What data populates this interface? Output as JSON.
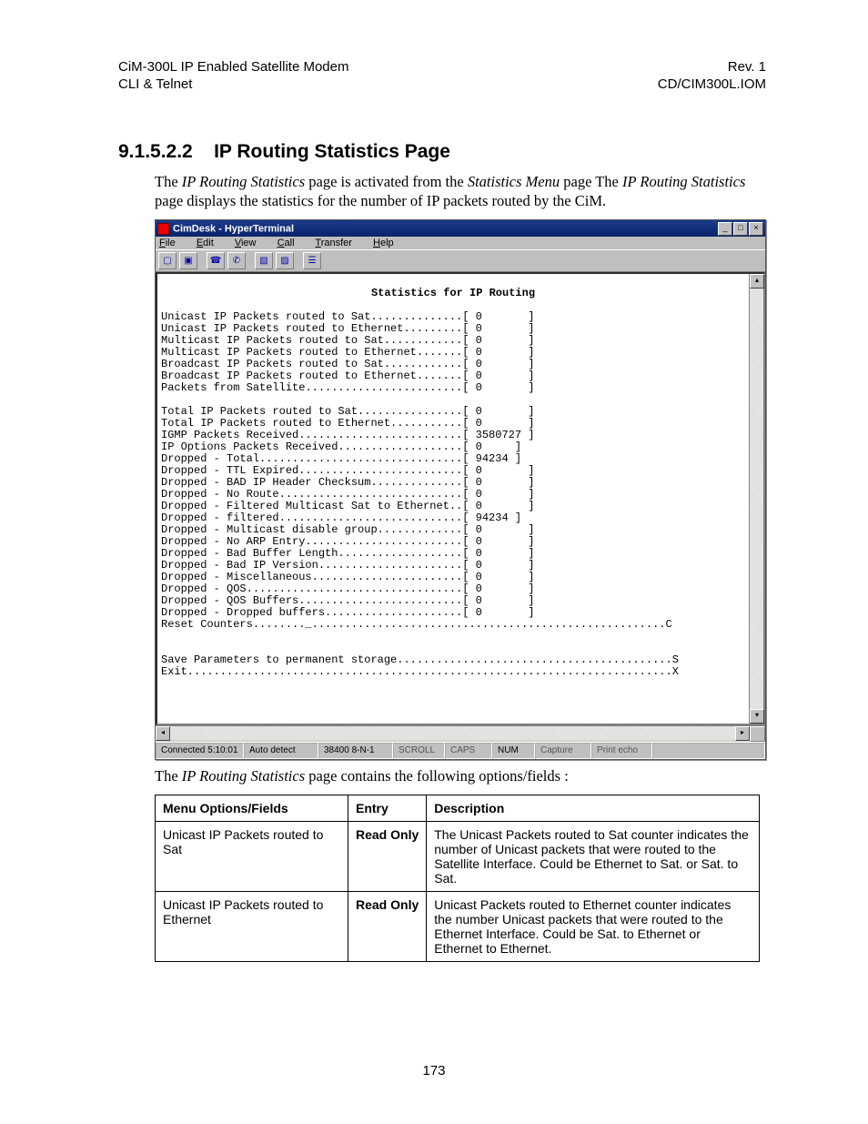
{
  "header": {
    "left_line1": "CiM-300L IP Enabled Satellite Modem",
    "left_line2": "CLI & Telnet",
    "right_line1": "Rev. 1",
    "right_line2": "CD/CIM300L.IOM"
  },
  "section": {
    "number": "9.1.5.2.2",
    "title": "IP Routing Statistics Page"
  },
  "intro": {
    "p1_pre": "The ",
    "p1_i1": "IP Routing Statistics",
    "p1_mid1": " page is activated from the ",
    "p1_i2": "Statistics Menu",
    "p1_mid2": " page The ",
    "p1_i3": "IP Routing Statistics",
    "p1_post": " page displays the statistics for the number of IP packets routed by the CiM."
  },
  "terminal": {
    "title": "CimDesk - HyperTerminal",
    "menus": {
      "file": "File",
      "edit": "Edit",
      "view": "View",
      "call": "Call",
      "transfer": "Transfer",
      "help": "Help"
    },
    "win_min": "_",
    "win_max": "□",
    "win_close": "×",
    "heading": "Statistics for IP Routing",
    "lines": [
      "Unicast IP Packets routed to Sat..............[ 0       ]",
      "Unicast IP Packets routed to Ethernet.........[ 0       ]",
      "Multicast IP Packets routed to Sat............[ 0       ]",
      "Multicast IP Packets routed to Ethernet.......[ 0       ]",
      "Broadcast IP Packets routed to Sat............[ 0       ]",
      "Broadcast IP Packets routed to Ethernet.......[ 0       ]",
      "Packets from Satellite........................[ 0       ]",
      "",
      "Total IP Packets routed to Sat................[ 0       ]",
      "Total IP Packets routed to Ethernet...........[ 0       ]",
      "IGMP Packets Received.........................[ 3580727 ]",
      "IP Options Packets Received...................[ 0     ]",
      "Dropped - Total...............................[ 94234 ]",
      "Dropped - TTL Expired.........................[ 0       ]",
      "Dropped - BAD IP Header Checksum..............[ 0       ]",
      "Dropped - No Route............................[ 0       ]",
      "Dropped - Filtered Multicast Sat to Ethernet..[ 0       ]",
      "Dropped - filtered............................[ 94234 ]",
      "Dropped - Multicast disable group.............[ 0       ]",
      "Dropped - No ARP Entry........................[ 0       ]",
      "Dropped - Bad Buffer Length...................[ 0       ]",
      "Dropped - Bad IP Version......................[ 0       ]",
      "Dropped - Miscellaneous.......................[ 0       ]",
      "Dropped - QOS.................................[ 0       ]",
      "Dropped - QOS Buffers.........................[ 0       ]",
      "Dropped - Dropped buffers.....................[ 0       ]",
      "Reset Counters........_......................................................C",
      "",
      "",
      "Save Parameters to permanent storage..........................................S",
      "Exit..........................................................................X"
    ],
    "status": {
      "connected": "Connected 5:10:01",
      "detect": "Auto detect",
      "baud": "38400 8-N-1",
      "scroll": "SCROLL",
      "caps": "CAPS",
      "num": "NUM",
      "capture": "Capture",
      "printecho": "Print echo"
    },
    "scroll_up": "▴",
    "scroll_down": "▾",
    "scroll_left": "◂",
    "scroll_right": "▸"
  },
  "after_term": {
    "pre": "The ",
    "ital": "IP Routing Statistics",
    "post": " page contains the following options/fields :"
  },
  "table": {
    "head": {
      "c1": "Menu Options/Fields",
      "c2": "Entry",
      "c3": "Description"
    },
    "rows": [
      {
        "c1": "Unicast IP Packets routed to Sat",
        "c2": "Read Only",
        "c3": "The Unicast Packets routed to Sat counter indicates the number of Unicast packets that were routed to the Satellite Interface. Could be Ethernet to Sat. or Sat. to Sat."
      },
      {
        "c1": "Unicast IP Packets routed to Ethernet",
        "c2": "Read Only",
        "c3": "Unicast Packets routed to Ethernet counter indicates the number Unicast packets that were routed to the Ethernet Interface. Could be Sat. to Ethernet or Ethernet to Ethernet."
      }
    ]
  },
  "page_number": "173",
  "chart_data": {
    "type": "table",
    "title": "Statistics for IP Routing",
    "rows": [
      {
        "label": "Unicast IP Packets routed to Sat",
        "value": 0
      },
      {
        "label": "Unicast IP Packets routed to Ethernet",
        "value": 0
      },
      {
        "label": "Multicast IP Packets routed to Sat",
        "value": 0
      },
      {
        "label": "Multicast IP Packets routed to Ethernet",
        "value": 0
      },
      {
        "label": "Broadcast IP Packets routed to Sat",
        "value": 0
      },
      {
        "label": "Broadcast IP Packets routed to Ethernet",
        "value": 0
      },
      {
        "label": "Packets from Satellite",
        "value": 0
      },
      {
        "label": "Total IP Packets routed to Sat",
        "value": 0
      },
      {
        "label": "Total IP Packets routed to Ethernet",
        "value": 0
      },
      {
        "label": "IGMP Packets Received",
        "value": 3580727
      },
      {
        "label": "IP Options Packets Received",
        "value": 0
      },
      {
        "label": "Dropped - Total",
        "value": 94234
      },
      {
        "label": "Dropped - TTL Expired",
        "value": 0
      },
      {
        "label": "Dropped - BAD IP Header Checksum",
        "value": 0
      },
      {
        "label": "Dropped - No Route",
        "value": 0
      },
      {
        "label": "Dropped - Filtered Multicast Sat to Ethernet",
        "value": 0
      },
      {
        "label": "Dropped - filtered",
        "value": 94234
      },
      {
        "label": "Dropped - Multicast disable group",
        "value": 0
      },
      {
        "label": "Dropped - No ARP Entry",
        "value": 0
      },
      {
        "label": "Dropped - Bad Buffer Length",
        "value": 0
      },
      {
        "label": "Dropped - Bad IP Version",
        "value": 0
      },
      {
        "label": "Dropped - Miscellaneous",
        "value": 0
      },
      {
        "label": "Dropped - QOS",
        "value": 0
      },
      {
        "label": "Dropped - QOS Buffers",
        "value": 0
      },
      {
        "label": "Dropped - Dropped buffers",
        "value": 0
      }
    ],
    "commands": [
      {
        "label": "Reset Counters",
        "key": "C"
      },
      {
        "label": "Save Parameters to permanent storage",
        "key": "S"
      },
      {
        "label": "Exit",
        "key": "X"
      }
    ]
  }
}
